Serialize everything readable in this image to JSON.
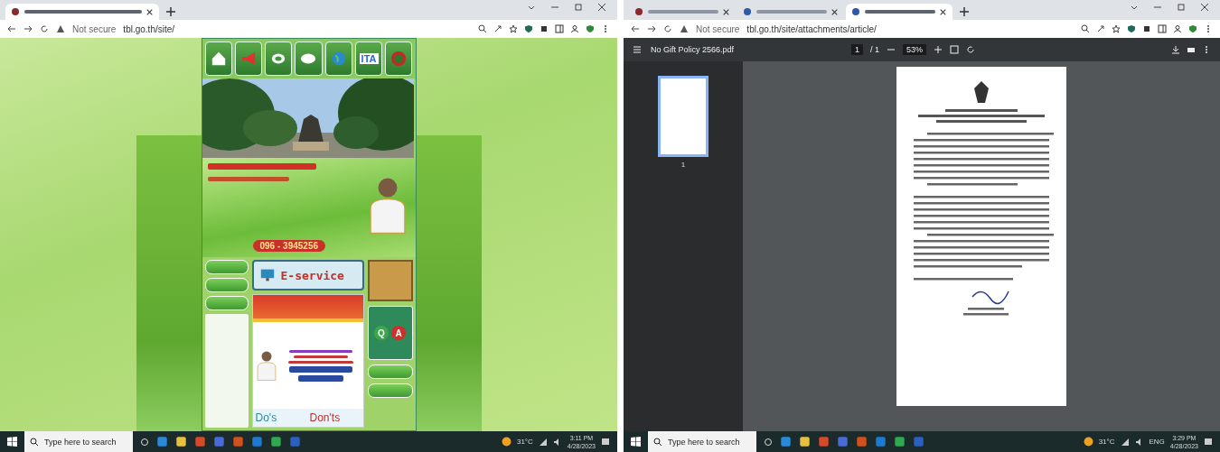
{
  "left_window": {
    "tabs": [
      {
        "kind": "site",
        "selected": true
      }
    ],
    "address": {
      "security": "Not secure",
      "url": "tbl.go.th/site/"
    },
    "page": {
      "nav_icons": [
        {
          "kind": "house"
        },
        {
          "kind": "megaphone"
        },
        {
          "kind": "chat"
        },
        {
          "kind": "bubble"
        },
        {
          "kind": "globe"
        },
        {
          "kind": "text",
          "label": "ITA"
        },
        {
          "kind": "seal"
        }
      ],
      "phone": "096 - 3945256",
      "eservice": "E-service",
      "side_buttons": [
        {
          "kind": "pill"
        },
        {
          "kind": "pill"
        },
        {
          "kind": "pill"
        }
      ],
      "poster": {
        "dos": "Do's",
        "donts": "Don'ts"
      },
      "qa": {
        "q": "Q",
        "a": "A"
      }
    }
  },
  "right_window": {
    "tabs": [
      {
        "kind": "site",
        "selected": false
      },
      {
        "kind": "globe",
        "selected": false
      },
      {
        "kind": "globe",
        "selected": true
      }
    ],
    "address": {
      "security": "Not secure",
      "url": "tbl.go.th/site/attachments/article/"
    },
    "pdf": {
      "file": "No Gift Policy 2566.pdf",
      "page": "1",
      "pages": "/ 1",
      "zoom": "53%",
      "thumb_label": "1"
    }
  },
  "taskbars": [
    {
      "search": "Type here to search",
      "temp": "31°C",
      "time": "3:11 PM",
      "date": "4/28/2023"
    },
    {
      "search": "Type here to search",
      "temp": "31°C",
      "lang": "ENG",
      "time": "3:29 PM",
      "date": "4/28/2023"
    }
  ]
}
